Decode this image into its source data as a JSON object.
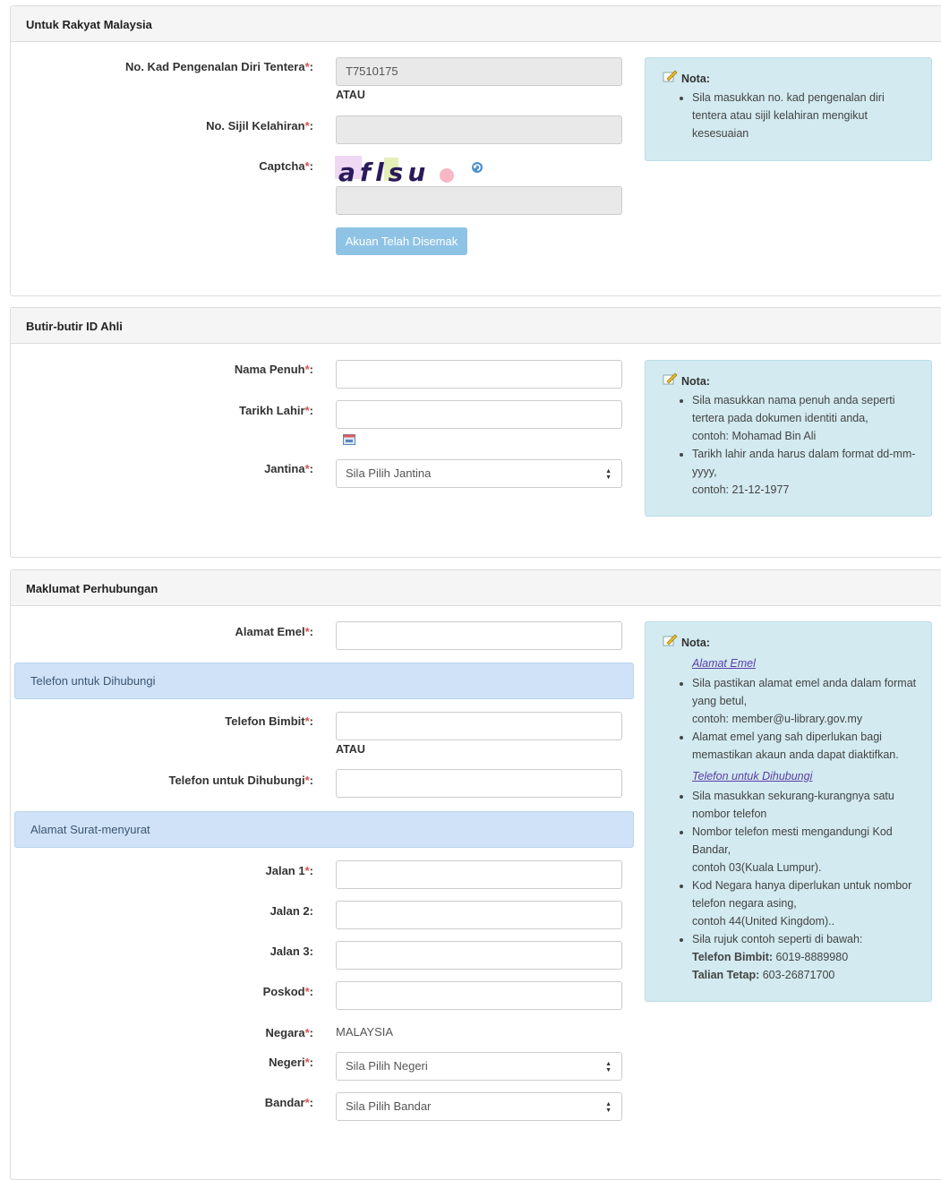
{
  "section1": {
    "title": "Untuk Rakyat Malaysia",
    "ic_label": "No. Kad Pengenalan Diri Tentera",
    "ic_value": "T7510175",
    "atau": "ATAU",
    "birth_cert_label": "No. Sijil Kelahiran",
    "birth_cert_value": "",
    "captcha_label": "Captcha",
    "captcha_text": "aflsu",
    "captcha_value": "",
    "submit_label": "Akuan Telah Disemak",
    "nota_title": "Nota:",
    "nota_items": [
      "Sila masukkan no. kad pengenalan diri tentera atau sijil kelahiran mengikut kesesuaian"
    ]
  },
  "section2": {
    "title": "Butir-butir ID Ahli",
    "name_label": "Nama Penuh",
    "name_value": "",
    "dob_label": "Tarikh Lahir",
    "dob_value": "",
    "gender_label": "Jantina",
    "gender_selected": "Sila Pilih Jantina",
    "nota_title": "Nota:",
    "nota_items": [
      "Sila masukkan nama penuh anda seperti tertera pada dokumen identiti anda,",
      "contoh: Mohamad Bin Ali",
      "Tarikh lahir anda harus dalam format dd-mm-yyyy,",
      "contoh: 21-12-1977"
    ]
  },
  "section3": {
    "title": "Maklumat Perhubungan",
    "email_label": "Alamat Emel",
    "email_value": "",
    "phone_bar": "Telefon untuk Dihubungi",
    "mobile_label": "Telefon Bimbit",
    "mobile_value": "",
    "atau": "ATAU",
    "contact_label": "Telefon untuk Dihubungi",
    "contact_value": "",
    "address_bar": "Alamat Surat-menyurat",
    "street1_label": "Jalan 1",
    "street2_label": "Jalan 2",
    "street3_label": "Jalan 3",
    "postcode_label": "Poskod",
    "country_label": "Negara",
    "country_value": "MALAYSIA",
    "state_label": "Negeri",
    "state_selected": "Sila Pilih Negeri",
    "city_label": "Bandar",
    "city_selected": "Sila Pilih Bandar",
    "nota_title": "Nota:",
    "nota_email_heading": "Alamat Emel",
    "nota_email_1": "Sila pastikan alamat emel anda dalam format yang betul,",
    "nota_email_1b": "contoh: member@u-library.gov.my",
    "nota_email_2": "Alamat emel yang sah diperlukan bagi memastikan akaun anda dapat diaktifkan.",
    "nota_phone_heading": "Telefon untuk Dihubungi",
    "nota_phone_1": "Sila masukkan sekurang-kurangnya satu nombor telefon",
    "nota_phone_2": "Nombor telefon mesti mengandungi Kod Bandar,",
    "nota_phone_2b": "contoh 03(Kuala Lumpur).",
    "nota_phone_3": "Kod Negara hanya diperlukan untuk nombor telefon negara asing,",
    "nota_phone_3b": "contoh 44(United Kingdom)..",
    "nota_phone_4": "Sila rujuk contoh seperti di bawah:",
    "nota_mobile_label": "Telefon Bimbit:",
    "nota_mobile_value": " 6019-8889980",
    "nota_landline_label": "Talian Tetap:",
    "nota_landline_value": " 603-26871700"
  },
  "common": {
    "required_mark": "*",
    "colon": ":"
  }
}
